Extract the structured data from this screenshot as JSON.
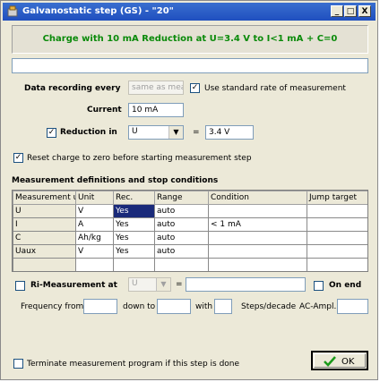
{
  "window": {
    "title": "Galvanostatic step (GS) - \"20\"",
    "minimize": "_",
    "maximize": "□",
    "close": "X"
  },
  "banner": "Charge with 10 mA  Reduction at U=3.4 V to I<1 mA + C=0",
  "comment_value": "",
  "data_recording": {
    "label": "Data recording every",
    "placeholder": "same as meas",
    "std_rate_label": "Use standard rate of measurement",
    "std_rate_checked": true
  },
  "current": {
    "label": "Current",
    "value": "10 mA"
  },
  "reduction": {
    "label": "Reduction in",
    "checked": true,
    "variable": "U",
    "equals": "=",
    "value": "3.4 V"
  },
  "reset_charge": {
    "label": "Reset charge to zero before starting measurement step",
    "checked": true
  },
  "grid": {
    "title": "Measurement definitions and stop conditions",
    "headers": [
      "Measurement u",
      "Unit",
      "Rec.",
      "Range",
      "Condition",
      "Jump target"
    ],
    "rows": [
      [
        "U",
        "V",
        "Yes",
        "auto",
        "",
        ""
      ],
      [
        "I",
        "A",
        "Yes",
        "auto",
        "< 1 mA",
        ""
      ],
      [
        "C",
        "Ah/kg",
        "Yes",
        "auto",
        "",
        ""
      ],
      [
        "Uaux",
        "V",
        "Yes",
        "auto",
        "",
        ""
      ],
      [
        "",
        "",
        "",
        "",
        "",
        ""
      ]
    ]
  },
  "ri": {
    "label": "Ri-Measurement at",
    "checked": false,
    "variable": "U",
    "equals": "=",
    "value": "",
    "on_end_label": "On end",
    "on_end_checked": false
  },
  "frequency": {
    "from_label": "Frequency from",
    "from_value": "",
    "down_to_label": "down to",
    "down_to_value": "",
    "with_label": "with",
    "with_value": "",
    "steps_label": "Steps/decade",
    "ac_label": "AC-Ampl.",
    "ac_value": ""
  },
  "terminate": {
    "label": "Terminate measurement program if this step is done",
    "checked": false
  },
  "ok_button": {
    "label": "OK"
  }
}
